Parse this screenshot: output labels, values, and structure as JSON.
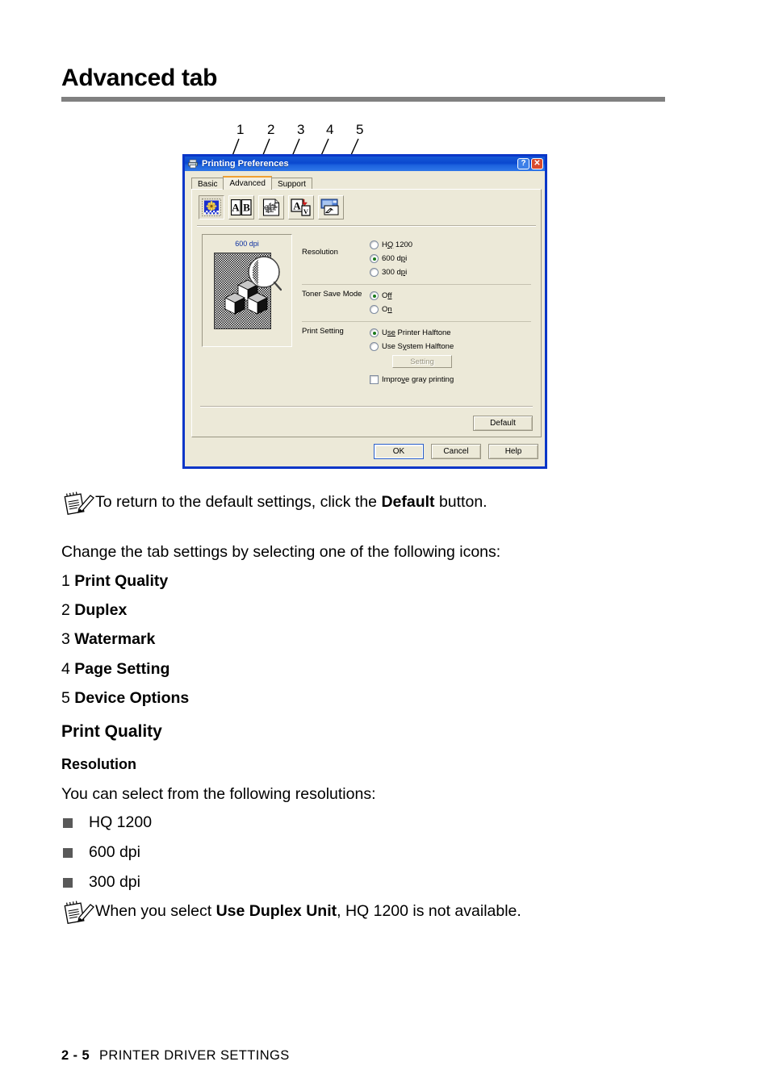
{
  "page": {
    "title": "Advanced tab",
    "footer_page": "2 - 5",
    "footer_section": "PRINTER DRIVER SETTINGS"
  },
  "callouts": {
    "numbers": [
      "1",
      "2",
      "3",
      "4",
      "5"
    ]
  },
  "dialog": {
    "title": "Printing Preferences",
    "titlebar_icon": "printer-icon",
    "help_button": "?",
    "close_button": "✕",
    "tabs": [
      {
        "label": "Basic",
        "active": false
      },
      {
        "label": "Advanced",
        "active": true
      },
      {
        "label": "Support",
        "active": false
      }
    ],
    "toolbar_icons": [
      {
        "name": "print-quality-icon",
        "pressed": true
      },
      {
        "name": "duplex-icon",
        "pressed": false
      },
      {
        "name": "watermark-icon",
        "pressed": false
      },
      {
        "name": "page-setting-icon",
        "pressed": false
      },
      {
        "name": "device-options-icon",
        "pressed": false
      }
    ],
    "preview": {
      "label": "600 dpi",
      "image": "halftone-cubes-magnifier-preview"
    },
    "groups": [
      {
        "label": "Resolution",
        "options": [
          {
            "label": "HQ 1200",
            "acc_before": "H",
            "acc": "Q",
            "acc_after": " 1200",
            "selected": false
          },
          {
            "label": "600 dpi",
            "acc_before": "600 d",
            "acc": "p",
            "acc_after": "i",
            "selected": true
          },
          {
            "label": "300 dpi",
            "acc_before": "300 d",
            "acc": "p",
            "acc_after": "i",
            "selected": false
          }
        ]
      },
      {
        "label": "Toner Save Mode",
        "options": [
          {
            "label": "Off",
            "acc_before": "O",
            "acc": "ff",
            "acc_after": "",
            "selected": true
          },
          {
            "label": "On",
            "acc_before": "O",
            "acc": "n",
            "acc_after": "",
            "selected": false
          }
        ]
      },
      {
        "label": "Print Setting",
        "options": [
          {
            "label": "Use Printer Halftone",
            "acc_before": "U",
            "acc": "se",
            "acc_after": " Printer Halftone",
            "selected": true
          },
          {
            "label": "Use System Halftone",
            "acc_before": "Use S",
            "acc": "y",
            "acc_after": "stem Halftone",
            "selected": false
          }
        ],
        "setting_button": {
          "label": "Setting",
          "disabled": true
        },
        "checkbox": {
          "label_before": "Impro",
          "acc": "v",
          "label_after": "e gray printing",
          "checked": false
        }
      }
    ],
    "buttons": {
      "default": "Default",
      "ok": "OK",
      "cancel": "Cancel",
      "help": "Help"
    }
  },
  "body": {
    "note1_pre": "To return to the default settings, click the ",
    "note1_bold": "Default",
    "note1_post": " button.",
    "intro": "Change the tab settings by selecting one of the following icons:",
    "icon_list": [
      {
        "num": "1",
        "name": "Print Quality"
      },
      {
        "num": "2",
        "name": "Duplex"
      },
      {
        "num": "3",
        "name": "Watermark"
      },
      {
        "num": "4",
        "name": "Page Setting"
      },
      {
        "num": "5",
        "name": "Device Options"
      }
    ],
    "heading2": "Print Quality",
    "heading3": "Resolution",
    "resolutions_intro": "You can select from the following resolutions:",
    "resolutions": [
      "HQ 1200",
      "600 dpi",
      "300 dpi"
    ],
    "note2_pre": "When you select ",
    "note2_bold": "Use Duplex Unit",
    "note2_post": ", HQ 1200 is not available."
  }
}
